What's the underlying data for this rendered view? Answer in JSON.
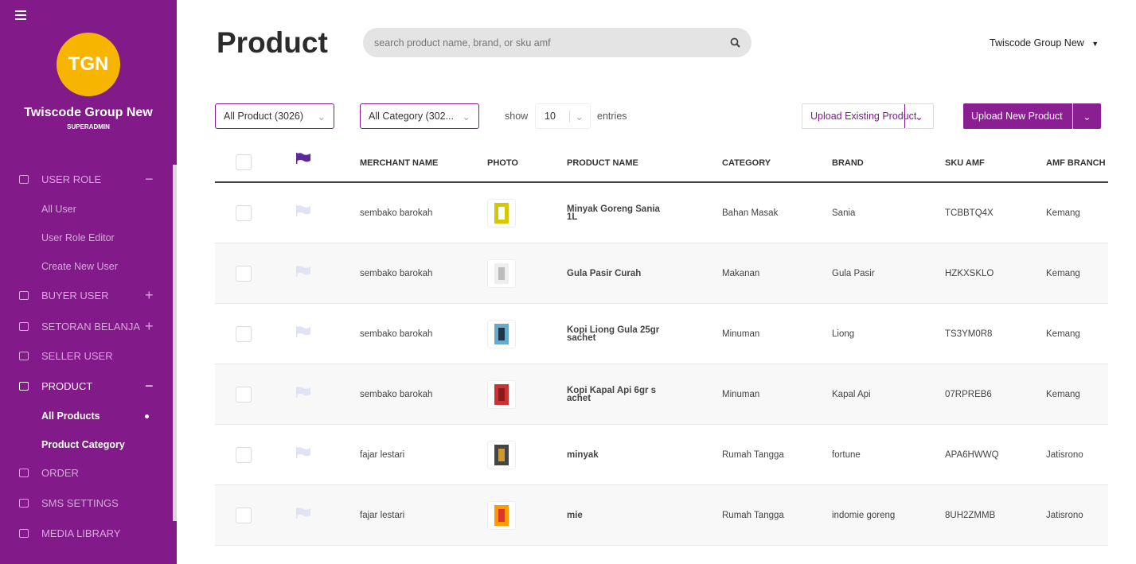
{
  "sidebar": {
    "avatar_initials": "TGN",
    "org_name": "Twiscode Group New",
    "role": "SUPERADMIN",
    "items": [
      {
        "label": "USER ROLE",
        "toggle": "−",
        "icon": "user-icon"
      },
      {
        "label": "All User"
      },
      {
        "label": "User Role Editor"
      },
      {
        "label": "Create New User"
      },
      {
        "label": "BUYER USER",
        "toggle": "+",
        "icon": "bag-icon"
      },
      {
        "label": "SETORAN BELANJA",
        "toggle": "+",
        "icon": "wallet-icon"
      },
      {
        "label": "SELLER USER",
        "icon": "store-icon"
      },
      {
        "label": "PRODUCT",
        "toggle": "−",
        "icon": "box-icon"
      },
      {
        "label": "All Products"
      },
      {
        "label": "Product Category"
      },
      {
        "label": "ORDER",
        "icon": "cart-icon"
      },
      {
        "label": "SMS SETTINGS",
        "icon": "sms-icon"
      },
      {
        "label": "MEDIA LIBRARY",
        "icon": "image-icon"
      }
    ]
  },
  "header": {
    "title": "Product",
    "search_placeholder": "search product name, brand, or sku amf",
    "account": "Twiscode Group New"
  },
  "toolbar": {
    "product_filter": "All Product (3026)",
    "category_filter": "All Category (302...",
    "show": "show",
    "entries_value": "10",
    "entries": "entries",
    "upload_existing": "Upload Existing Product",
    "upload_new": "Upload New Product"
  },
  "colors": {
    "brand": "#821a8a",
    "avatar": "#f7b500"
  },
  "table": {
    "headers": [
      "MERCHANT NAME",
      "PHOTO",
      "PRODUCT NAME",
      "CATEGORY",
      "BRAND",
      "SKU AMF",
      "AMF BRANCH"
    ],
    "rows": [
      {
        "merchant": "sembako barokah",
        "product": "Minyak Goreng Sania 1L",
        "category": "Bahan Masak",
        "brand": "Sania",
        "sku": "TCBBTQ4X",
        "branch": "Kemang"
      },
      {
        "merchant": "sembako barokah",
        "product": "Gula Pasir Curah",
        "category": "Makanan",
        "brand": "Gula Pasir",
        "sku": "HZKXSKLO",
        "branch": "Kemang"
      },
      {
        "merchant": "sembako barokah",
        "product": "Kopi Liong Gula 25gr sachet",
        "category": "Minuman",
        "brand": "Liong",
        "sku": "TS3YM0R8",
        "branch": "Kemang"
      },
      {
        "merchant": "sembako barokah",
        "product": "Kopi Kapal Api 6gr s achet",
        "category": "Minuman",
        "brand": "Kapal Api",
        "sku": "07RPREB6",
        "branch": "Kemang"
      },
      {
        "merchant": "fajar lestari",
        "product": "minyak",
        "category": "Rumah Tangga",
        "brand": "fortune",
        "sku": "APA6HWWQ",
        "branch": "Jatisrono"
      },
      {
        "merchant": "fajar lestari",
        "product": "mie",
        "category": "Rumah Tangga",
        "brand": "indomie goreng",
        "sku": "8UH2ZMMB",
        "branch": "Jatisrono"
      }
    ]
  }
}
